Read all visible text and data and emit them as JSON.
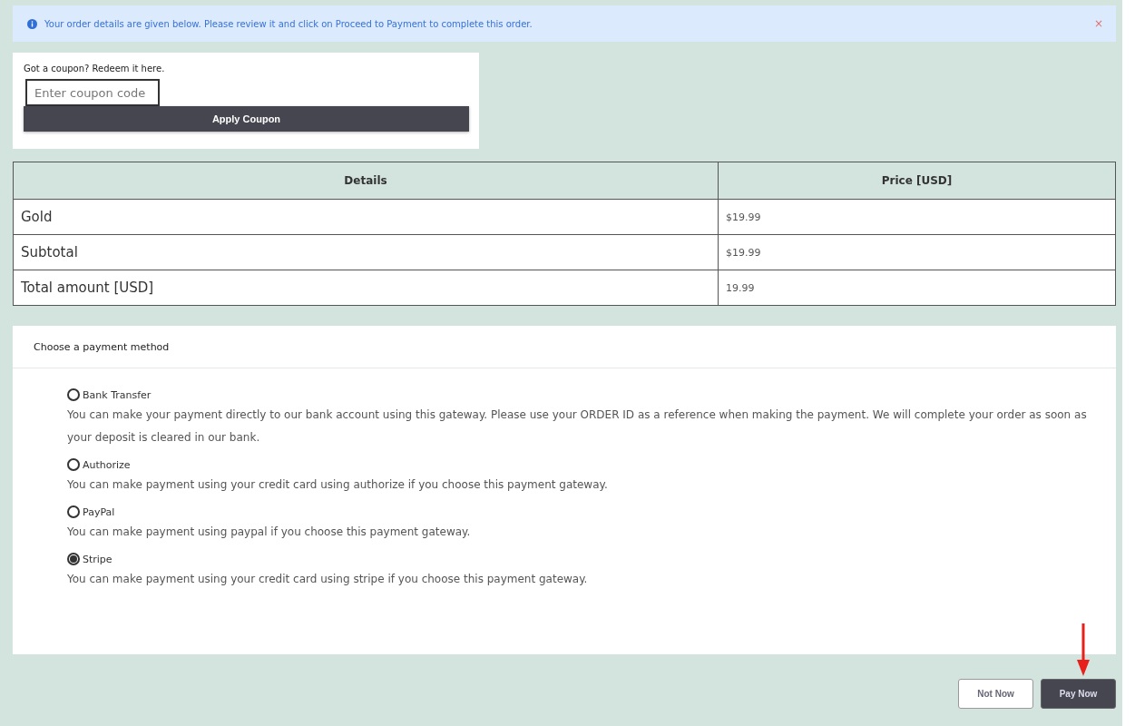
{
  "alert": {
    "message": "Your order details are given below. Please review it and click on Proceed to Payment to complete this order.",
    "close": "×"
  },
  "coupon": {
    "prompt": "Got a coupon? Redeem it here.",
    "placeholder": "Enter coupon code",
    "button": "Apply Coupon"
  },
  "table": {
    "columns": [
      "Details",
      "Price [USD]"
    ],
    "rows": [
      {
        "details": "Gold",
        "price": "$19.99"
      },
      {
        "details": "Subtotal",
        "price": "$19.99"
      },
      {
        "details": "Total amount [USD]",
        "price": "19.99"
      }
    ]
  },
  "payment": {
    "title": "Choose a payment method",
    "methods": [
      {
        "label": "Bank Transfer",
        "description": "You can make your payment directly to our bank account using this gateway. Please use your ORDER ID as a reference when making the payment. We will complete your order as soon as your deposit is cleared in our bank.",
        "selected": false
      },
      {
        "label": "Authorize",
        "description": "You can make payment using your credit card using authorize if you choose this payment gateway.",
        "selected": false
      },
      {
        "label": "PayPal",
        "description": "You can make payment using paypal if you choose this payment gateway.",
        "selected": false
      },
      {
        "label": "Stripe",
        "description": "You can make payment using your credit card using stripe if you choose this payment gateway.",
        "selected": true
      }
    ]
  },
  "buttons": [
    "Not Now",
    "Pay Now"
  ]
}
